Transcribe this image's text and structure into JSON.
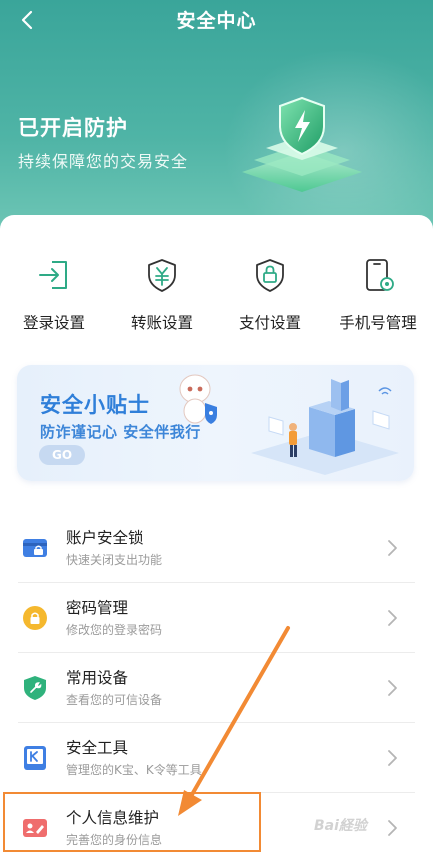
{
  "header": {
    "title": "安全中心",
    "hero_title": "已开启防护",
    "hero_subtitle": "持续保障您的交易安全"
  },
  "quick_actions": [
    {
      "label": "登录设置",
      "icon": "login-icon"
    },
    {
      "label": "转账设置",
      "icon": "yuan-shield-icon"
    },
    {
      "label": "支付设置",
      "icon": "lock-shield-icon"
    },
    {
      "label": "手机号管理",
      "icon": "phone-settings-icon"
    }
  ],
  "banner": {
    "title": "安全小贴士",
    "subtitle": "防诈谨记心 安全伴我行",
    "go_label": "GO"
  },
  "settings_list": [
    {
      "title": "账户安全锁",
      "subtitle": "快速关闭支出功能",
      "icon": "card-lock-icon",
      "color": "#3f7fe3"
    },
    {
      "title": "密码管理",
      "subtitle": "修改您的登录密码",
      "icon": "lock-icon",
      "color": "#f5b82e"
    },
    {
      "title": "常用设备",
      "subtitle": "查看您的可信设备",
      "icon": "wrench-shield-icon",
      "color": "#2fb27c"
    },
    {
      "title": "安全工具",
      "subtitle": "管理您的K宝、K令等工具",
      "icon": "k-tool-icon",
      "color": "#3f7fe3"
    },
    {
      "title": "个人信息维护",
      "subtitle": "完善您的身份信息",
      "icon": "id-card-icon",
      "color": "#ef6d6d"
    }
  ],
  "colors": {
    "header_teal": "#3aa59a",
    "banner_blue": "#2f7fd9",
    "annotation_orange": "#f28a34"
  }
}
